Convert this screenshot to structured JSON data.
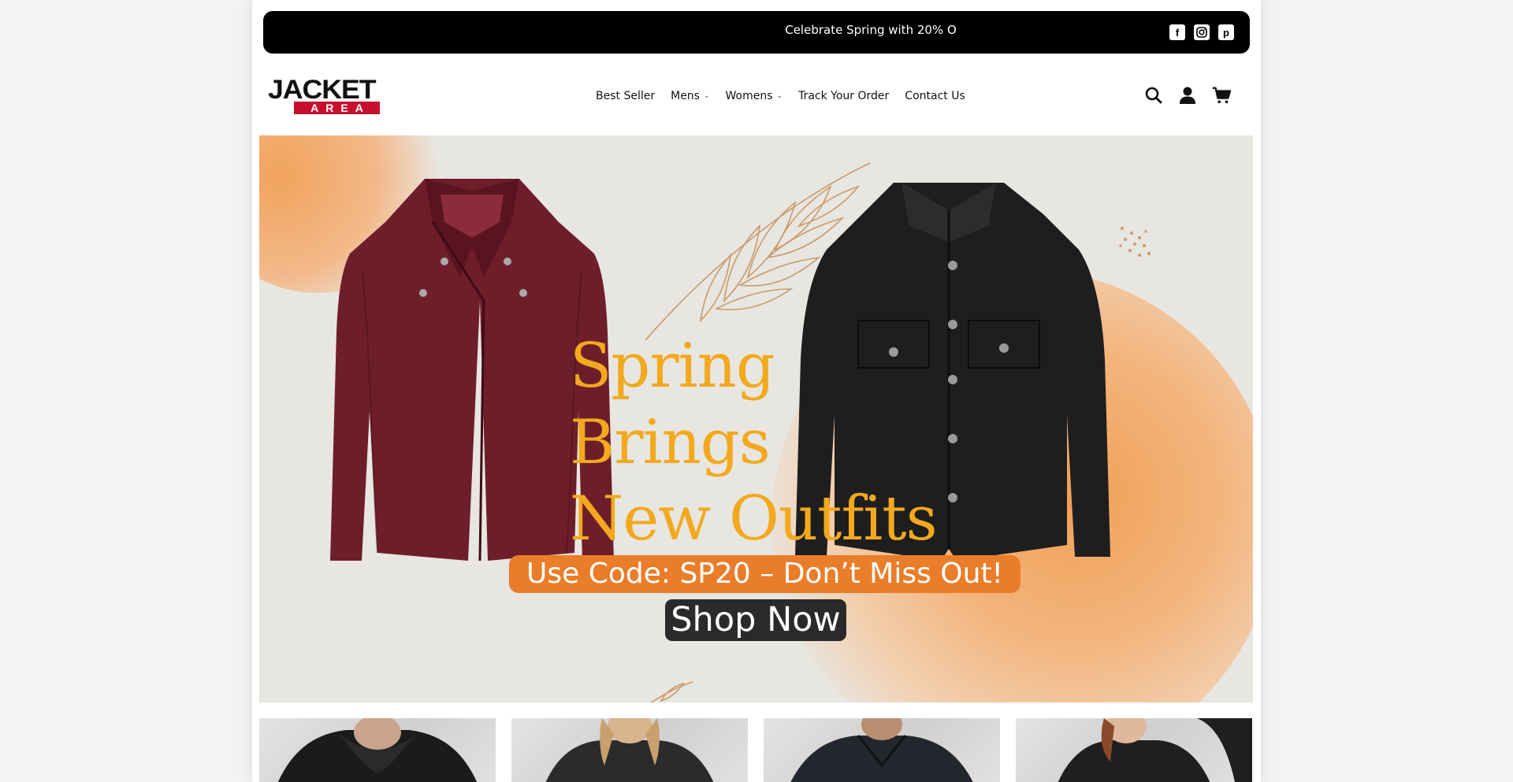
{
  "announcement": {
    "text": "Celebrate Spring with 20% O",
    "social_icons": [
      "facebook-icon",
      "instagram-icon",
      "pinterest-icon"
    ]
  },
  "logo": {
    "top": "JACKET",
    "bottom": "AREA"
  },
  "nav": {
    "items": [
      {
        "label": "Best Seller",
        "has_dropdown": false
      },
      {
        "label": "Mens",
        "has_dropdown": true
      },
      {
        "label": "Womens",
        "has_dropdown": true
      },
      {
        "label": "Track Your Order",
        "has_dropdown": false
      },
      {
        "label": "Contact Us",
        "has_dropdown": false
      }
    ]
  },
  "header_icons": [
    "search-icon",
    "account-icon",
    "cart-icon"
  ],
  "hero": {
    "headline": [
      "Spring",
      "Brings",
      "New Outfits"
    ],
    "promo": "Use Code: SP20 – Don’t Miss Out!",
    "cta": "Shop Now"
  },
  "colors": {
    "accent": "#f2a91d",
    "promo_bg": "#ea7d2a",
    "logo_red": "#c8102e",
    "announcement_bg": "#000000"
  }
}
